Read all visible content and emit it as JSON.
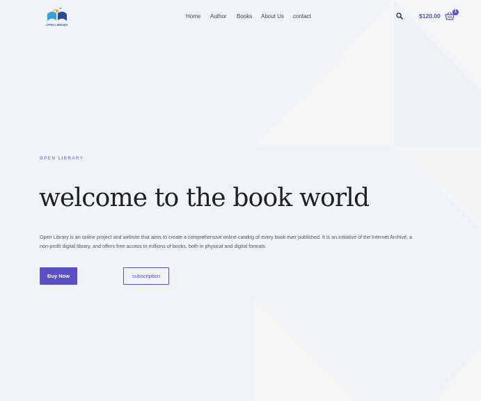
{
  "header": {
    "logo_text": "OPEN LIBRARY",
    "nav": [
      {
        "label": "Home"
      },
      {
        "label": "Author"
      },
      {
        "label": "Books"
      },
      {
        "label": "About Us"
      },
      {
        "label": "contact"
      }
    ],
    "search_icon": "search-icon",
    "cart_price": "$120.00",
    "cart_count": "1",
    "cart_icon": "shopping-basket-icon"
  },
  "hero": {
    "eyebrow": "OPEN LIBRARY",
    "title": "welcome to the book world",
    "description": "Open Library is an online project and website that aims to create a comprehensive online catalog of every book ever published. It is an initiative of the Internet Archive, a non-profit digital library, and offers free access to millions of books, both in physical and digital formats",
    "primary_button": "Buy Now",
    "secondary_button": "subscription"
  },
  "colors": {
    "accent": "#5a4fc4",
    "background": "#f0f3f7",
    "shape": "#f6f6f7"
  }
}
